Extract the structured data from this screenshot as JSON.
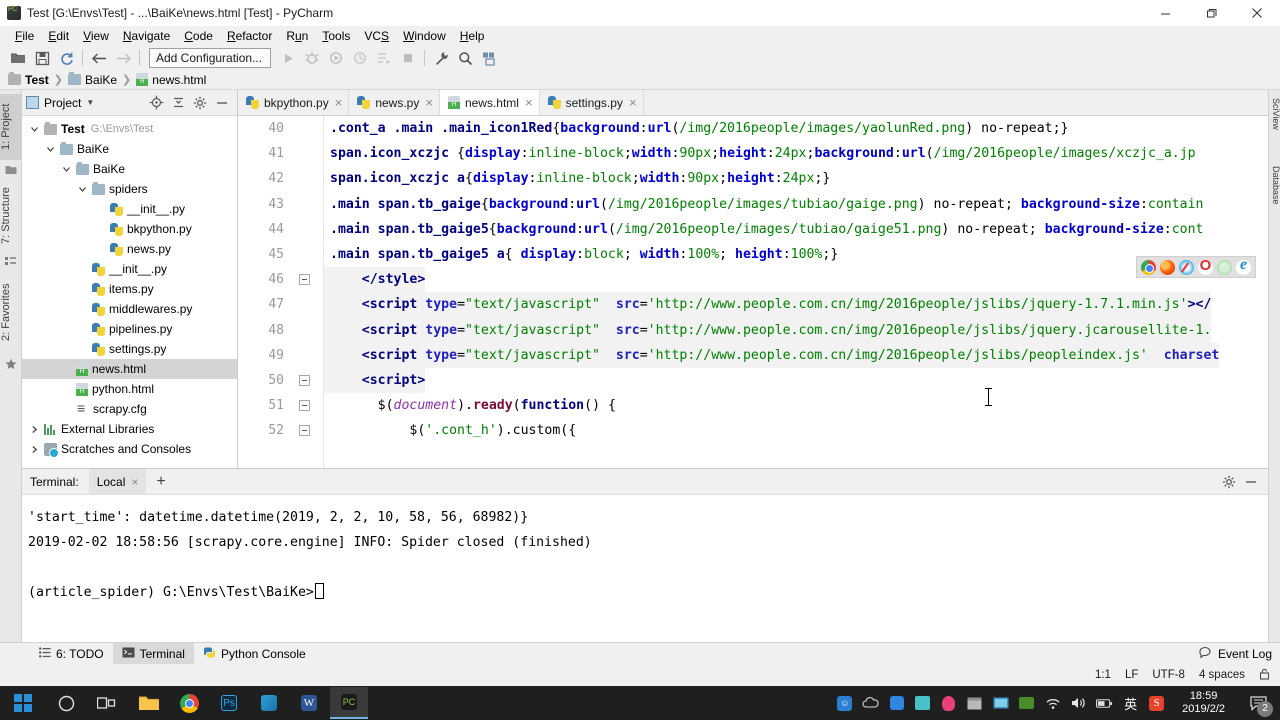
{
  "window": {
    "title": "Test [G:\\Envs\\Test] - ...\\BaiKe\\news.html [Test] - PyCharm",
    "app_icon": "pycharm-icon",
    "minimize": "minimize-icon",
    "maximize": "restore-icon",
    "close": "close-icon"
  },
  "menu": [
    {
      "label": "File"
    },
    {
      "label": "Edit"
    },
    {
      "label": "View"
    },
    {
      "label": "Navigate"
    },
    {
      "label": "Code"
    },
    {
      "label": "Refactor"
    },
    {
      "label": "Run"
    },
    {
      "label": "Tools"
    },
    {
      "label": "VCS"
    },
    {
      "label": "Window"
    },
    {
      "label": "Help"
    }
  ],
  "toolbar": {
    "run_config_label": "Add Configuration...",
    "icons": [
      "open-folder-icon",
      "save-all-icon",
      "sync-refresh-icon",
      "back-arrow-icon",
      "forward-arrow-icon",
      "run-icon",
      "debug-icon",
      "run-coverage-icon",
      "profile-icon",
      "run-with-console-icon",
      "stop-icon",
      "settings-wrench-icon",
      "search-everywhere-icon",
      "update-project-icon"
    ]
  },
  "breadcrumb": [
    {
      "label": "Test",
      "icon": "folder-icon"
    },
    {
      "label": "BaiKe",
      "icon": "folder-icon"
    },
    {
      "label": "news.html",
      "icon": "html-file-icon"
    }
  ],
  "left_stripe": [
    {
      "label": "1: Project",
      "active": true
    },
    {
      "label": "7: Structure",
      "active": false
    },
    {
      "label": "2: Favorites",
      "active": false
    }
  ],
  "right_stripe": [
    {
      "label": "SciView"
    },
    {
      "label": "Database"
    }
  ],
  "project_panel": {
    "title": "Project",
    "icon": "project-icon",
    "caret": "chevron-down-icon",
    "actions": [
      "locate-target-icon",
      "collapse-all-icon",
      "settings-gear-icon",
      "hide-panel-icon"
    ],
    "tree": [
      {
        "depth": 0,
        "twisty": "expanded",
        "icon": "folder-icon",
        "label": "Test",
        "bold": true,
        "path": "G:\\Envs\\Test",
        "selected": false
      },
      {
        "depth": 1,
        "twisty": "expanded",
        "icon": "folder-blue-icon",
        "label": "BaiKe",
        "bold": false,
        "path": "",
        "selected": false
      },
      {
        "depth": 2,
        "twisty": "expanded",
        "icon": "folder-blue-icon",
        "label": "BaiKe",
        "bold": false,
        "path": "",
        "selected": false
      },
      {
        "depth": 3,
        "twisty": "expanded",
        "icon": "folder-blue-icon",
        "label": "spiders",
        "bold": false,
        "path": "",
        "selected": false
      },
      {
        "depth": 4,
        "twisty": "none",
        "icon": "python-file-icon",
        "label": "__init__.py",
        "bold": false,
        "path": "",
        "selected": false
      },
      {
        "depth": 4,
        "twisty": "none",
        "icon": "python-file-icon",
        "label": "bkpython.py",
        "bold": false,
        "path": "",
        "selected": false
      },
      {
        "depth": 4,
        "twisty": "none",
        "icon": "python-file-icon",
        "label": "news.py",
        "bold": false,
        "path": "",
        "selected": false
      },
      {
        "depth": 3,
        "twisty": "none",
        "icon": "python-file-icon",
        "label": "__init__.py",
        "bold": false,
        "path": "",
        "selected": false
      },
      {
        "depth": 3,
        "twisty": "none",
        "icon": "python-file-icon",
        "label": "items.py",
        "bold": false,
        "path": "",
        "selected": false
      },
      {
        "depth": 3,
        "twisty": "none",
        "icon": "python-file-icon",
        "label": "middlewares.py",
        "bold": false,
        "path": "",
        "selected": false
      },
      {
        "depth": 3,
        "twisty": "none",
        "icon": "python-file-icon",
        "label": "pipelines.py",
        "bold": false,
        "path": "",
        "selected": false
      },
      {
        "depth": 3,
        "twisty": "none",
        "icon": "python-file-icon",
        "label": "settings.py",
        "bold": false,
        "path": "",
        "selected": false
      },
      {
        "depth": 2,
        "twisty": "none",
        "icon": "html-file-icon",
        "label": "news.html",
        "bold": false,
        "path": "",
        "selected": true
      },
      {
        "depth": 2,
        "twisty": "none",
        "icon": "html-file-icon",
        "label": "python.html",
        "bold": false,
        "path": "",
        "selected": false
      },
      {
        "depth": 2,
        "twisty": "none",
        "icon": "config-file-icon",
        "label": "scrapy.cfg",
        "bold": false,
        "path": "",
        "selected": false
      },
      {
        "depth": 0,
        "twisty": "collapsed",
        "icon": "libraries-icon",
        "label": "External Libraries",
        "bold": false,
        "path": "",
        "selected": false
      },
      {
        "depth": 0,
        "twisty": "collapsed",
        "icon": "scratches-icon",
        "label": "Scratches and Consoles",
        "bold": false,
        "path": "",
        "selected": false
      }
    ]
  },
  "editor": {
    "tabs": [
      {
        "label": "bkpython.py",
        "icon": "python-file-icon",
        "active": false,
        "close": "×"
      },
      {
        "label": "news.py",
        "icon": "python-file-icon",
        "active": false,
        "close": "×"
      },
      {
        "label": "news.html",
        "icon": "html-file-icon",
        "active": true,
        "close": "×"
      },
      {
        "label": "settings.py",
        "icon": "python-file-icon",
        "active": false,
        "close": "×"
      }
    ],
    "first_line_number": 40,
    "lines": [
      {
        "n": "40",
        "fold": "none",
        "text": ".cont_a .main .main_icon1Red{background:url(/img/2016people/images/yaolunRed.png) no-repeat;}"
      },
      {
        "n": "41",
        "fold": "none",
        "text": "span.icon_xczjc {display:inline-block;width:90px;height:24px;background:url(/img/2016people/images/xczjc_a.jp"
      },
      {
        "n": "42",
        "fold": "none",
        "text": "span.icon_xczjc a{display:inline-block;width:90px;height:24px;}"
      },
      {
        "n": "43",
        "fold": "none",
        "text": ".main span.tb_gaige{background:url(/img/2016people/images/tubiao/gaige.png) no-repeat; background-size:contain"
      },
      {
        "n": "44",
        "fold": "none",
        "text": ".main span.tb_gaige5{background:url(/img/2016people/images/tubiao/gaige51.png) no-repeat; background-size:cont"
      },
      {
        "n": "45",
        "fold": "none",
        "text": ".main span.tb_gaige5 a{ display:block; width:100%; height:100%;}"
      },
      {
        "n": "46",
        "fold": "minus",
        "text": "    </style>"
      },
      {
        "n": "47",
        "fold": "none",
        "text": "    <script type=\"text/javascript\" src='http://www.people.com.cn/img/2016people/jslibs/jquery-1.7.1.min.js'></"
      },
      {
        "n": "48",
        "fold": "none",
        "text": "    <script type=\"text/javascript\" src='http://www.people.com.cn/img/2016people/jslibs/jquery.jcarousellite-1."
      },
      {
        "n": "49",
        "fold": "none",
        "text": "    <script type=\"text/javascript\" src='http://www.people.com.cn/img/2016people/jslibs/peopleindex.js' charset"
      },
      {
        "n": "50",
        "fold": "minus",
        "text": "    <script>"
      },
      {
        "n": "51",
        "fold": "minus",
        "text": "      $(document).ready(function() {"
      },
      {
        "n": "52",
        "fold": "minus",
        "text": "          $('.cont_h').custom({"
      }
    ],
    "browser_preview_icons": [
      "chrome-icon",
      "firefox-icon",
      "safari-icon",
      "opera-icon",
      "edge-legacy-icon",
      "internet-explorer-icon"
    ],
    "inspection_widget": "inspections-eye-icon"
  },
  "terminal": {
    "label": "Terminal:",
    "tab_label": "Local",
    "tab_close": "×",
    "add_label": "+",
    "actions": [
      "settings-gear-icon",
      "hide-panel-icon"
    ],
    "output": [
      "'start_time': datetime.datetime(2019, 2, 2, 10, 58, 56, 68982)}",
      "2019-02-02 18:58:56 [scrapy.core.engine] INFO: Spider closed (finished)"
    ],
    "prompt": "(article_spider) G:\\Envs\\Test\\BaiKe>"
  },
  "bottom_tabs": [
    {
      "label": "6: TODO",
      "icon": "todo-icon",
      "active": false
    },
    {
      "label": "Terminal",
      "icon": "terminal-icon",
      "active": true
    },
    {
      "label": "Python Console",
      "icon": "python-console-icon",
      "active": false
    }
  ],
  "bottom_right": {
    "event_log_label": "Event Log",
    "event_log_icon": "event-log-icon"
  },
  "status_line": {
    "caret_position": "1:1",
    "line_separator": "LF",
    "encoding": "UTF-8",
    "indent": "4 spaces",
    "lock_icon": "unlocked-icon"
  },
  "taskbar": {
    "start_icon": "windows-start-icon",
    "search_icon": "search-circle-icon",
    "taskview_icon": "task-view-icon",
    "apps": [
      {
        "name": "file-explorer-icon",
        "active": false
      },
      {
        "name": "chrome-icon",
        "active": false
      },
      {
        "name": "photoshop-icon",
        "active": false
      },
      {
        "name": "store-icon",
        "active": false
      },
      {
        "name": "word-icon",
        "active": false
      },
      {
        "name": "pycharm-icon",
        "active": true
      }
    ],
    "tray": [
      "qq-icon",
      "onedrive-icon",
      "blue-dot-icon",
      "mail-icon",
      "penguin-icon",
      "window-icon",
      "monitor-icon",
      "nvidia-icon",
      "wifi-icon",
      "volume-icon",
      "battery-icon",
      "ime-chinese-icon",
      "sogou-icon"
    ],
    "clock_time": "18:59",
    "clock_date": "2019/2/2",
    "notification_icon": "action-center-icon",
    "notification_count": "2"
  },
  "colors": {
    "accent": "#4a86c8",
    "selection": "#d4d4d4",
    "syntax_selector": "#000080",
    "syntax_property": "#0000d0",
    "syntax_value": "#008000",
    "syntax_function": "#7a0a3a",
    "syntax_doc": "#8e2fae",
    "taskbar_bg": "#1f1f1f"
  }
}
